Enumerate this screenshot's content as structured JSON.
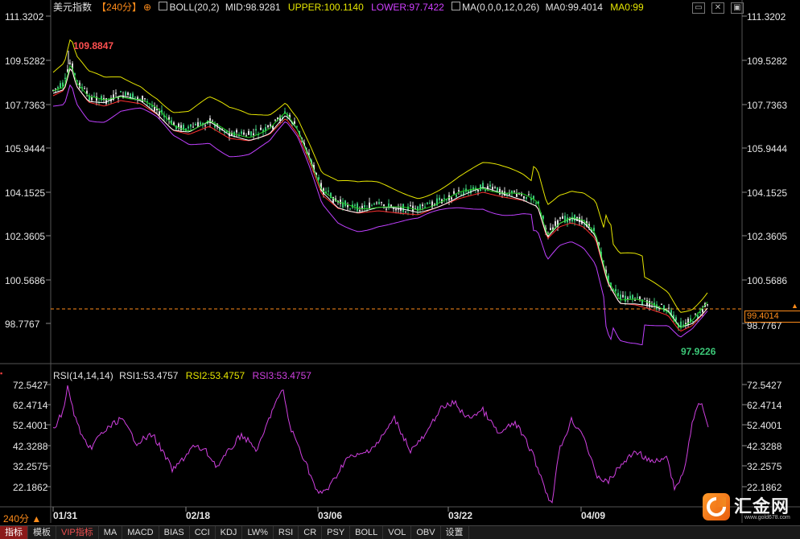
{
  "main_header": {
    "symbol": "美元指数",
    "period": "【240分】",
    "period_icon": "plus-circle-icon",
    "boll_label": "BOLL(20,2)",
    "mid": "MID:98.9281",
    "upper": "UPPER:100.1140",
    "lower": "LOWER:97.7422",
    "ma_label": "MA(0,0,0,12,0,26)",
    "ma0_a": "MA0:99.4014",
    "ma0_b": "MA0:99"
  },
  "price_axis": [
    "111.3202",
    "109.5282",
    "107.7363",
    "105.9444",
    "104.1525",
    "102.3605",
    "100.5686",
    "98.7767"
  ],
  "price_axis_right_last": "98.7767",
  "price_annotations": {
    "high": "109.8847",
    "low": "97.9226",
    "current": "99.4014"
  },
  "rsi_header": {
    "label": "RSI(14,14,14)",
    "rsi1": "RSI1:53.4757",
    "rsi2": "RSI2:53.4757",
    "rsi3": "RSI3:53.4757"
  },
  "rsi_axis": [
    "72.5427",
    "62.4714",
    "52.4001",
    "42.3288",
    "32.2575",
    "22.1862"
  ],
  "date_axis": [
    "01/31",
    "02/18",
    "03/06",
    "03/22",
    "04/09"
  ],
  "period_selector": "240分 ▲",
  "bottom_tabs": [
    "指标",
    "模板",
    "VIP指标",
    "MA",
    "MACD",
    "BIAS",
    "CCI",
    "KDJ",
    "LW%",
    "RSI",
    "CR",
    "PSY",
    "BOLL",
    "VOL",
    "OBV",
    "设置"
  ],
  "logo": {
    "name": "汇金网",
    "url": "www.gold678.com"
  },
  "colors": {
    "background": "#000000",
    "up_candle": "#3cc878",
    "down_candle": "#e0e0e0",
    "boll_upper": "#e6e600",
    "boll_lower": "#c040ff",
    "ma_red": "#ff3030",
    "ma_white": "#ffffff",
    "ma_green": "#22cc22",
    "rsi_line": "#d040e0",
    "current_price": "#ff8c1a"
  }
}
